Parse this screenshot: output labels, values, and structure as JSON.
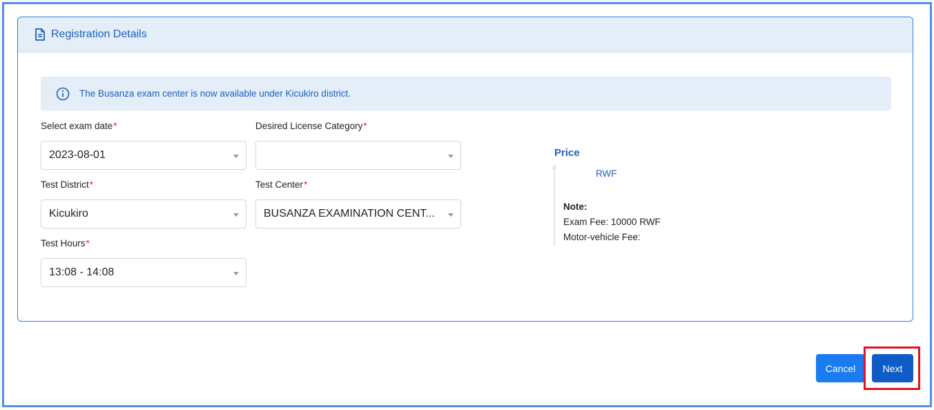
{
  "header": {
    "title": "Registration Details",
    "icon": "document-icon"
  },
  "alert": {
    "icon": "info-icon",
    "message": "The Busanza exam center is now available under Kicukiro district."
  },
  "form": {
    "exam_date": {
      "label": "Select exam date",
      "required_mark": "*",
      "value": "2023-08-01"
    },
    "license_category": {
      "label": "Desired License Category",
      "required_mark": "*",
      "value": ""
    },
    "test_district": {
      "label": "Test District",
      "required_mark": "*",
      "value": "Kicukiro"
    },
    "test_center": {
      "label": "Test Center",
      "required_mark": "*",
      "value": "BUSANZA EXAMINATION CENT..."
    },
    "test_hours": {
      "label": "Test Hours",
      "required_mark": "*",
      "value": "13:08 - 14:08"
    }
  },
  "price": {
    "title": "Price",
    "currency": "RWF",
    "note_title": "Note:",
    "exam_fee": "Exam Fee: 10000 RWF",
    "motor_vehicle_fee": "Motor-vehicle Fee:"
  },
  "actions": {
    "cancel_label": "Cancel",
    "next_label": "Next"
  },
  "colors": {
    "accent": "#1f5fbf",
    "primary_button": "#1a7cf0",
    "highlight": "#e0141e",
    "frame": "#4f8fe8"
  }
}
